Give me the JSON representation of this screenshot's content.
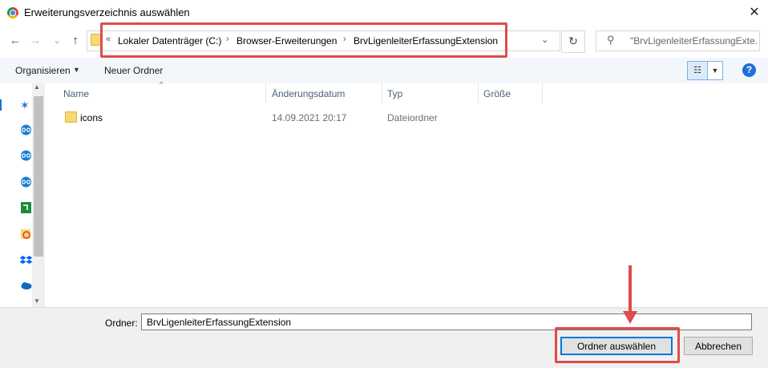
{
  "window": {
    "title": "Erweiterungsverzeichnis auswählen",
    "close_glyph": "✕"
  },
  "nav": {
    "back": "←",
    "forward": "→",
    "recent": "⌄",
    "up": "↑"
  },
  "address": {
    "overflow": "«",
    "crumbs": [
      "Lokaler Datenträger (C:)",
      "Browser-Erweiterungen",
      "BrvLigenleiterErfassungExtension"
    ],
    "separator": "›",
    "dropdown": "⌄",
    "refresh": "↻"
  },
  "search": {
    "placeholder": "\"BrvLigenleiterErfassungExte..."
  },
  "toolbar": {
    "organize": "Organisieren",
    "organize_caret": "▼",
    "new_folder": "Neuer Ordner",
    "view_glyph": "☷",
    "view_caret": "▼",
    "help": "?"
  },
  "columns": {
    "name": "Name",
    "modified": "Änderungsdatum",
    "type": "Typ",
    "size": "Größe",
    "sort": "^"
  },
  "rows": [
    {
      "name": "icons",
      "modified": "14.09.2021 20:17",
      "type": "Dateiordner",
      "size": ""
    }
  ],
  "navpane": {
    "icons": [
      "pin-icon",
      "nextcloud-icon",
      "nextcloud-icon",
      "nextcloud-icon",
      "green-app-icon",
      "adobe-folder-icon",
      "dropbox-icon",
      "onedrive-icon"
    ]
  },
  "footer": {
    "folder_label": "Ordner:",
    "folder_value": "BrvLigenleiterErfassungExtension",
    "select_button": "Ordner auswählen",
    "cancel_button": "Abbrechen"
  },
  "colors": {
    "annotation": "#e04b4b",
    "accent": "#0078d7"
  }
}
